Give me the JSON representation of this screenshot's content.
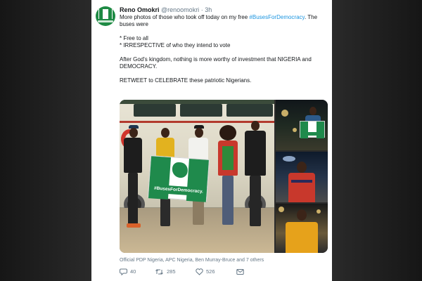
{
  "tweet": {
    "author_name": "Reno Omokri",
    "handle": "@renoomokri",
    "separator": "·",
    "time": "3h",
    "text": {
      "line1_prefix": "More photos of those who took off today on my free ",
      "line1_hashtag": "#BusesForDemocracy",
      "line1_suffix": ". The",
      "line2": "buses were",
      "bullet1": "* Free to all",
      "bullet2": "* IRRESPECTIVE of who they intend to vote",
      "line3": "After God's kingdom, nothing is more worthy of investment that NIGERIA and",
      "line4": "DEMOCRACY.",
      "line5": "RETWEET to CELEBRATE these patriotic Nigerians."
    },
    "media": {
      "banner_text": "#BusesForDemocracy."
    },
    "tagged": "Official PDP Nigeria, APC Nigeria, Ben Murray-Bruce and 7 others",
    "actions": {
      "replies": "40",
      "retweets": "285",
      "likes": "526"
    },
    "colors": {
      "link": "#1b95e0",
      "brand_green": "#1f8a4c",
      "muted": "#657786"
    }
  },
  "icons": [
    "reply-icon",
    "retweet-icon",
    "like-icon",
    "message-icon"
  ]
}
